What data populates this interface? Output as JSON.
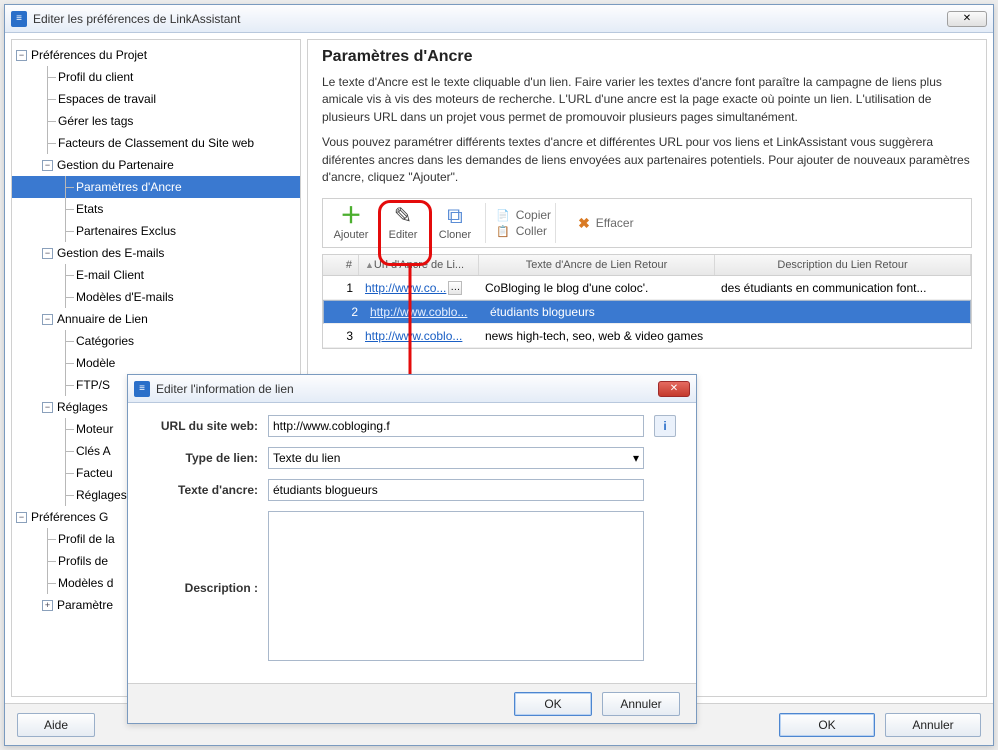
{
  "window": {
    "title": "Editer les préférences de LinkAssistant"
  },
  "tree": {
    "n0": "Préférences du Projet",
    "n0_0": "Profil du client",
    "n0_1": "Espaces de travail",
    "n0_2": "Gérer les tags",
    "n0_3": "Facteurs de Classement du Site web",
    "n0_4": "Gestion du Partenaire",
    "n0_4_0": "Paramètres d'Ancre",
    "n0_4_1": "Etats",
    "n0_4_2": "Partenaires Exclus",
    "n0_5": "Gestion des E-mails",
    "n0_5_0": "E-mail Client",
    "n0_5_1": "Modèles d'E-mails",
    "n0_6": "Annuaire de Lien",
    "n0_6_0": "Catégories",
    "n0_6_1": "Modèle",
    "n0_6_2": "FTP/S",
    "n0_7": "Réglages",
    "n0_7_0": "Moteur",
    "n0_7_1": "Clés A",
    "n0_7_2": "Facteu",
    "n0_7_3": "Réglages",
    "n1": "Préférences G",
    "n1_0": "Profil de la",
    "n1_1": "Profils de",
    "n1_2": "Modèles d",
    "n1_3": "Paramètre"
  },
  "content": {
    "title": "Paramètres d'Ancre",
    "para1": "Le texte d'Ancre est le texte cliquable d'un lien. Faire varier les textes d'ancre font paraître la campagne de liens plus amicale vis à vis des moteurs de recherche. L'URL d'une ancre est la page exacte où pointe un lien. L'utilisation de plusieurs URL dans un projet vous permet de promouvoir plusieurs pages simultanément.",
    "para2": "Vous pouvez paramétrer différents textes d'ancre et différentes URL pour vos liens et LinkAssistant vous suggèrera diférentes ancres dans les demandes de liens envoyées aux partenaires potentiels. Pour ajouter de nouveaux paramètres d'ancre, cliquez \"Ajouter\"."
  },
  "toolbar": {
    "add": "Ajouter",
    "edit": "Editer",
    "clone": "Cloner",
    "copy": "Copier",
    "paste": "Coller",
    "delete": "Effacer"
  },
  "table": {
    "headers": {
      "num": "#",
      "url": "Url d'Ancre de Li...",
      "text": "Texte d'Ancre de Lien Retour",
      "desc": "Description du Lien Retour"
    },
    "rows": [
      {
        "n": "1",
        "url": "http://www.co...",
        "text": "CoBloging le blog d'une coloc'.",
        "desc": "des étudiants en communication font..."
      },
      {
        "n": "2",
        "url": "http://www.coblo...",
        "text": "étudiants blogueurs",
        "desc": ""
      },
      {
        "n": "3",
        "url": "http://www.coblo...",
        "text": "news high-tech, seo, web & video games",
        "desc": ""
      }
    ]
  },
  "footer": {
    "help": "Aide",
    "ok": "OK",
    "cancel": "Annuler"
  },
  "dialog": {
    "title": "Editer l'information de lien",
    "url_label": "URL du site web:",
    "url_value": "http://www.cobloging.f",
    "type_label": "Type de lien:",
    "type_value": "Texte du lien",
    "anchor_label": "Texte d'ancre:",
    "anchor_value": "étudiants blogueurs",
    "desc_label": "Description :",
    "desc_value": "",
    "ok": "OK",
    "cancel": "Annuler"
  }
}
